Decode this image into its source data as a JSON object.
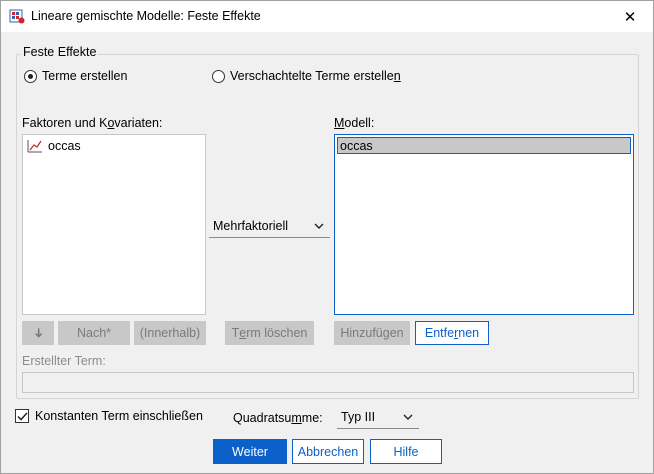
{
  "window": {
    "title": "Lineare gemischte Modelle: Feste Effekte",
    "close_glyph": "✕"
  },
  "group": {
    "legend": "Feste Effekte",
    "radio_build": "Terme erstellen",
    "radio_nested_prefix": "Verschachtelte Terme erstelle",
    "radio_nested_ul": "n"
  },
  "factors": {
    "label_prefix": "Faktoren und K",
    "label_ul": "o",
    "label_suffix": "variaten:",
    "items": [
      "occas"
    ]
  },
  "model": {
    "label_ul": "M",
    "label_suffix": "odell:",
    "items": [
      "occas"
    ]
  },
  "build_type": {
    "selected": "Mehrfaktoriell"
  },
  "buttons": {
    "arrow_glyph": "➜",
    "nach": "Nach*",
    "innerhalb": "(Innerhalb)",
    "term_loeschen_prefix": "T",
    "term_loeschen_ul": "e",
    "term_loeschen_suffix": "rm löschen",
    "hinzufuegen": "Hinzufügen",
    "entfernen_prefix": "Entfe",
    "entfernen_ul": "r",
    "entfernen_suffix": "nen"
  },
  "built_term": {
    "label": "Erstellter Term:",
    "value": ""
  },
  "footer": {
    "include_intercept": "Konstanten Term einschließen",
    "include_checked": true,
    "sum_squares_prefix": "Quadratsu",
    "sum_squares_ul": "m",
    "sum_squares_suffix": "me:",
    "sum_squares_value": "Typ III",
    "weiter": "Weiter",
    "abbrechen": "Abbrechen",
    "hilfe": "Hilfe"
  }
}
